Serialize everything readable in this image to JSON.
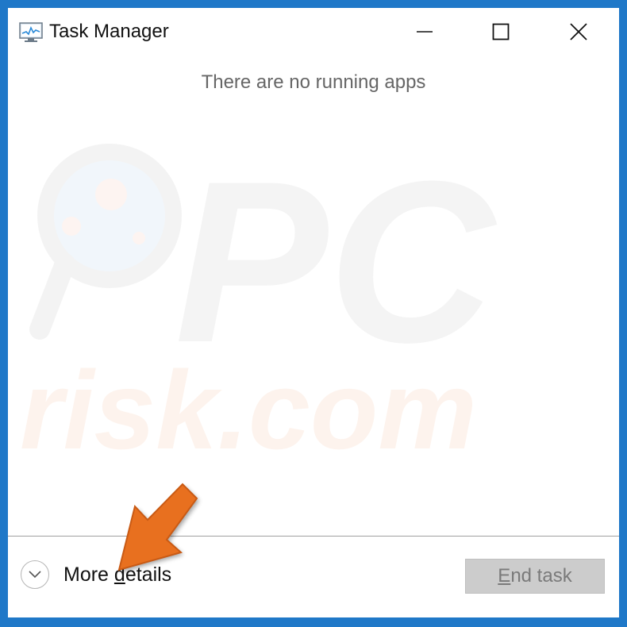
{
  "window": {
    "title": "Task Manager",
    "controls": {
      "minimize": "minimize",
      "maximize": "maximize",
      "close": "close"
    }
  },
  "main": {
    "empty_message": "There are no running apps"
  },
  "footer": {
    "more_details_prefix": "More ",
    "more_details_mnemonic": "d",
    "more_details_suffix": "etails",
    "end_task_mnemonic": "E",
    "end_task_suffix": "nd task",
    "end_task_enabled": false
  },
  "watermark": {
    "line1": "PC",
    "line2": "risk.com"
  },
  "colors": {
    "border": "#1f78c8",
    "annotation_arrow": "#e8701f"
  },
  "icons": {
    "app": "task-manager-icon",
    "more_details": "chevron-down-icon",
    "annotation": "arrow-pointer-icon"
  }
}
